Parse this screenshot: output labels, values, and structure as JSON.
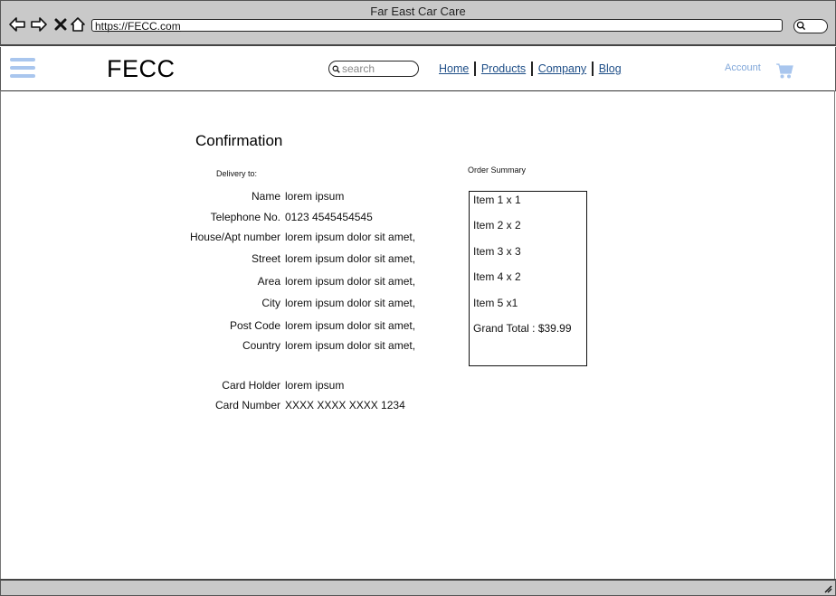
{
  "window": {
    "title": "Far East Car Care"
  },
  "browser": {
    "url": "https://FECC.com"
  },
  "header": {
    "logo": "FECC",
    "search_placeholder": "search",
    "nav": [
      {
        "label": "Home"
      },
      {
        "label": "Products"
      },
      {
        "label": "Company"
      },
      {
        "label": "Blog"
      }
    ],
    "account_label": "Account",
    "accent_color": "#a9c6ee"
  },
  "page": {
    "title": "Confirmation",
    "delivery_label": "Delivery to:",
    "fields": [
      {
        "label": "Name",
        "value": "lorem ipsum"
      },
      {
        "label": "Telephone No.",
        "value": "0123 4545454545"
      },
      {
        "label": "House/Apt number",
        "value": "lorem ipsum dolor sit amet,"
      },
      {
        "label": "Street",
        "value": "lorem ipsum dolor sit amet,"
      },
      {
        "label": "Area",
        "value": "lorem ipsum dolor sit amet,"
      },
      {
        "label": "City",
        "value": "lorem ipsum dolor sit amet,"
      },
      {
        "label": "Post Code",
        "value": "lorem ipsum dolor sit amet,"
      },
      {
        "label": "Country",
        "value": "lorem ipsum dolor sit amet,"
      }
    ],
    "card": [
      {
        "label": "Card Holder",
        "value": "lorem ipsum"
      },
      {
        "label": "Card Number",
        "value": "XXXX XXXX XXXX 1234"
      }
    ]
  },
  "order_summary": {
    "label": "Order Summary",
    "items": [
      "Item 1 x 1",
      "Item 2 x 2",
      "Item 3 x 3",
      "Item 4 x 2",
      "Item 5 x1"
    ],
    "grand_total": "Grand Total : $39.99"
  }
}
